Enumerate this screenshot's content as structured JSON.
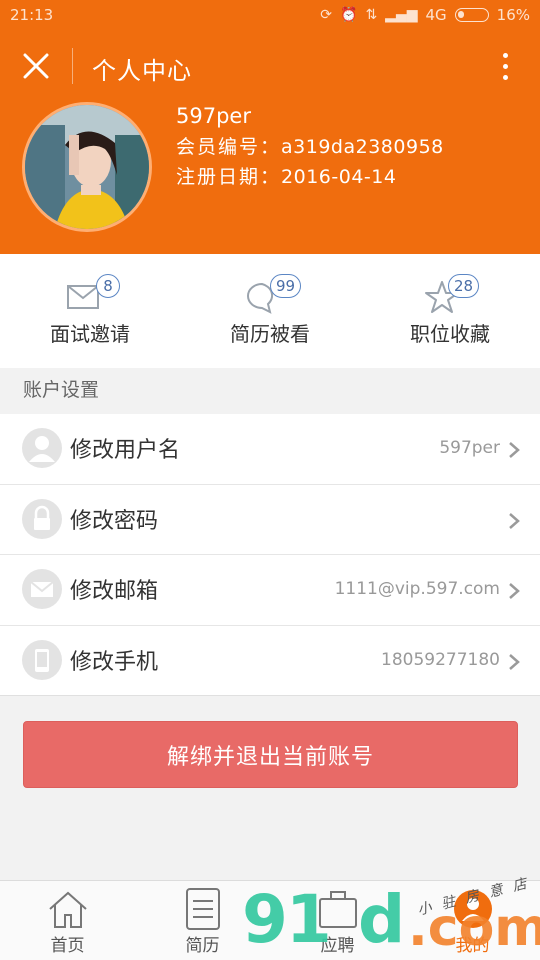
{
  "status_bar": {
    "time": "21:13",
    "network": "4G",
    "battery": "16%"
  },
  "header": {
    "title": "个人中心",
    "close_icon": "close-icon",
    "more_icon": "more-vertical-icon"
  },
  "profile": {
    "username": "597per",
    "member_id_label": "会员编号：",
    "member_id": "a319da2380958",
    "register_date_label": "注册日期：",
    "register_date": "2016-04-14"
  },
  "stats": [
    {
      "label": "面试邀请",
      "count": "8",
      "icon": "mail-icon"
    },
    {
      "label": "简历被看",
      "count": "99",
      "icon": "chat-bubble-icon"
    },
    {
      "label": "职位收藏",
      "count": "28",
      "icon": "star-icon"
    }
  ],
  "account_settings": {
    "title": "账户设置",
    "items": [
      {
        "label": "修改用户名",
        "value": "597per",
        "icon": "user-icon"
      },
      {
        "label": "修改密码",
        "value": "",
        "icon": "lock-icon"
      },
      {
        "label": "修改邮箱",
        "value": "1111@vip.597.com",
        "icon": "envelope-icon"
      },
      {
        "label": "修改手机",
        "value": "18059277180",
        "icon": "phone-icon"
      }
    ]
  },
  "logout_button": "解绑并退出当前账号",
  "bottom_nav": [
    {
      "label": "首页",
      "icon": "home-icon"
    },
    {
      "label": "简历",
      "icon": "resume-icon"
    },
    {
      "label": "应聘",
      "icon": "briefcase-icon"
    },
    {
      "label": "我的",
      "icon": "profile-icon",
      "active": true
    }
  ],
  "watermark": {
    "main": "91",
    "mid": "d",
    "com": ".com",
    "small": "小 驻 房 意 店"
  },
  "colors": {
    "brand_orange": "#f06d0e",
    "logout_red": "#e86a67",
    "badge_blue": "#5b86c4"
  }
}
